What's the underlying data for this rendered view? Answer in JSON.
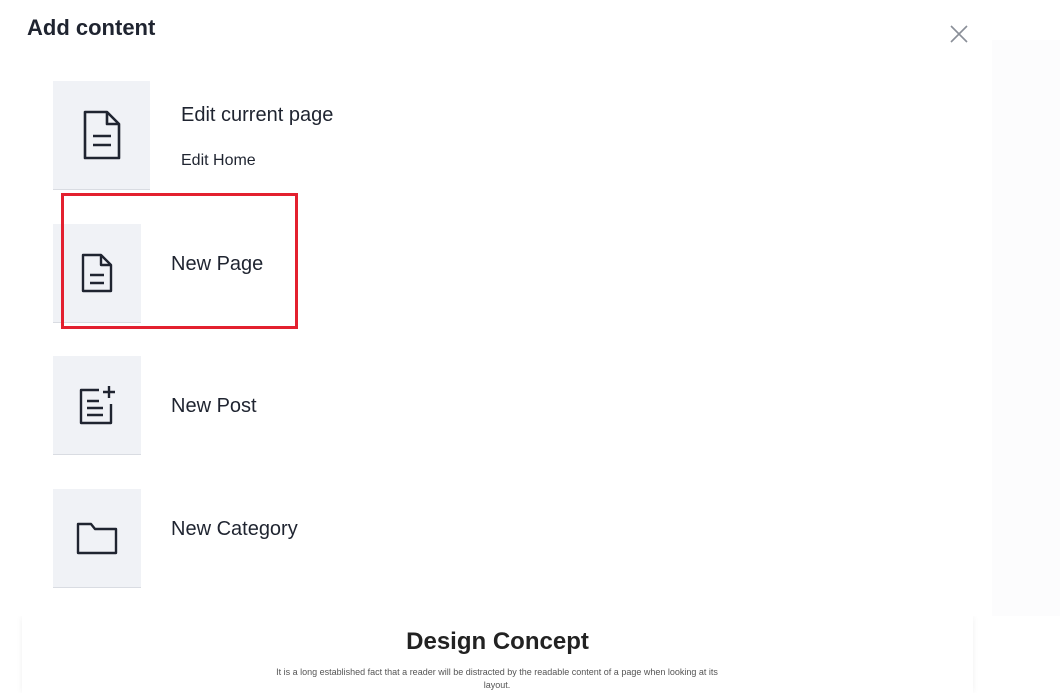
{
  "panel": {
    "title": "Add content",
    "close_icon": "close-icon"
  },
  "options": [
    {
      "label": "Edit current page",
      "sublabel": "Edit Home",
      "icon": "document-icon"
    },
    {
      "label": "New Page",
      "icon": "document-icon"
    },
    {
      "label": "New Post",
      "icon": "document-plus-icon"
    },
    {
      "label": "New Category",
      "icon": "folder-icon"
    }
  ],
  "background_site": {
    "title": "Design Concept",
    "text": "It is a long established fact that a reader will be distracted by the readable content of a page when looking at its layout."
  },
  "colors": {
    "tile_background": "#f0f2f6",
    "highlight": "#e3202f",
    "text": "#1f2430"
  }
}
